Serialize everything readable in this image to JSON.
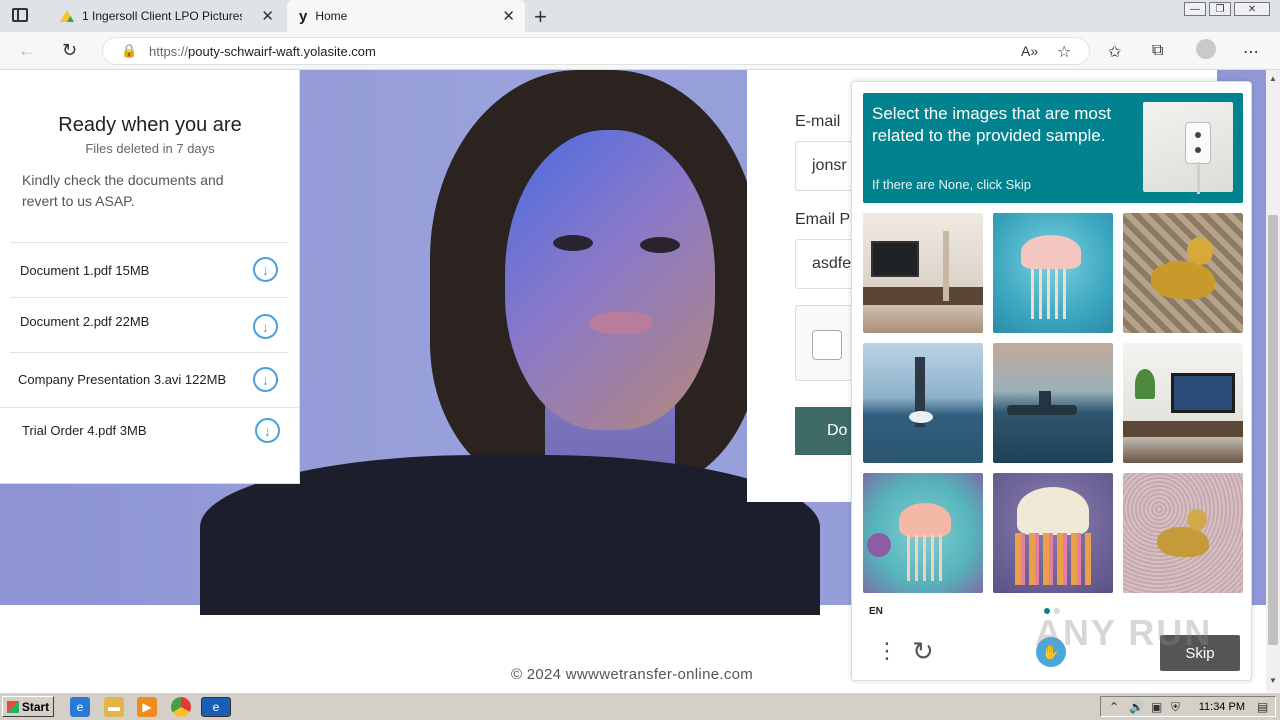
{
  "browser": {
    "tabs": [
      {
        "label": "1 Ingersoll Client LPO Pictures &",
        "icon": "google-drive-icon",
        "active": false
      },
      {
        "label": "Home",
        "icon": "yola-icon",
        "active": true
      }
    ],
    "url_prefix": "https://",
    "url_domain": "pouty-schwairf-waft.yolasite.com"
  },
  "doc_card": {
    "title": "Ready when you are",
    "subtitle": "Files deleted in 7 days",
    "message": "Kindly check the documents and revert to us ASAP.",
    "documents": [
      {
        "name": "Document 1.pdf 15MB"
      },
      {
        "name": "Document 2.pdf 22MB"
      },
      {
        "name": "Company Presentation 3.avi 122MB"
      },
      {
        "name": "Trial Order 4.pdf 3MB"
      }
    ]
  },
  "form": {
    "email_label": "E-mail",
    "email_value": "jonsr",
    "password_label": "Email P",
    "password_value": "asdfe",
    "button_label": "Do"
  },
  "footer": {
    "copyright": "© 2024 wwwwetransfer-online.com"
  },
  "captcha": {
    "prompt": "Select the images that are most related to the provided sample.",
    "hint": "If there are None, click Skip",
    "sample": "power-outlet",
    "tiles": [
      "living-room-tv",
      "jellyfish",
      "golden-duck",
      "submarine",
      "submarine",
      "living-room-tv",
      "jellyfish",
      "jellyfish",
      "golden-duck"
    ],
    "language": "EN",
    "skip_label": "Skip",
    "accent": "#00838f"
  },
  "watermark": "ANY RUN",
  "taskbar": {
    "start_label": "Start",
    "clock": "11:34 PM"
  }
}
